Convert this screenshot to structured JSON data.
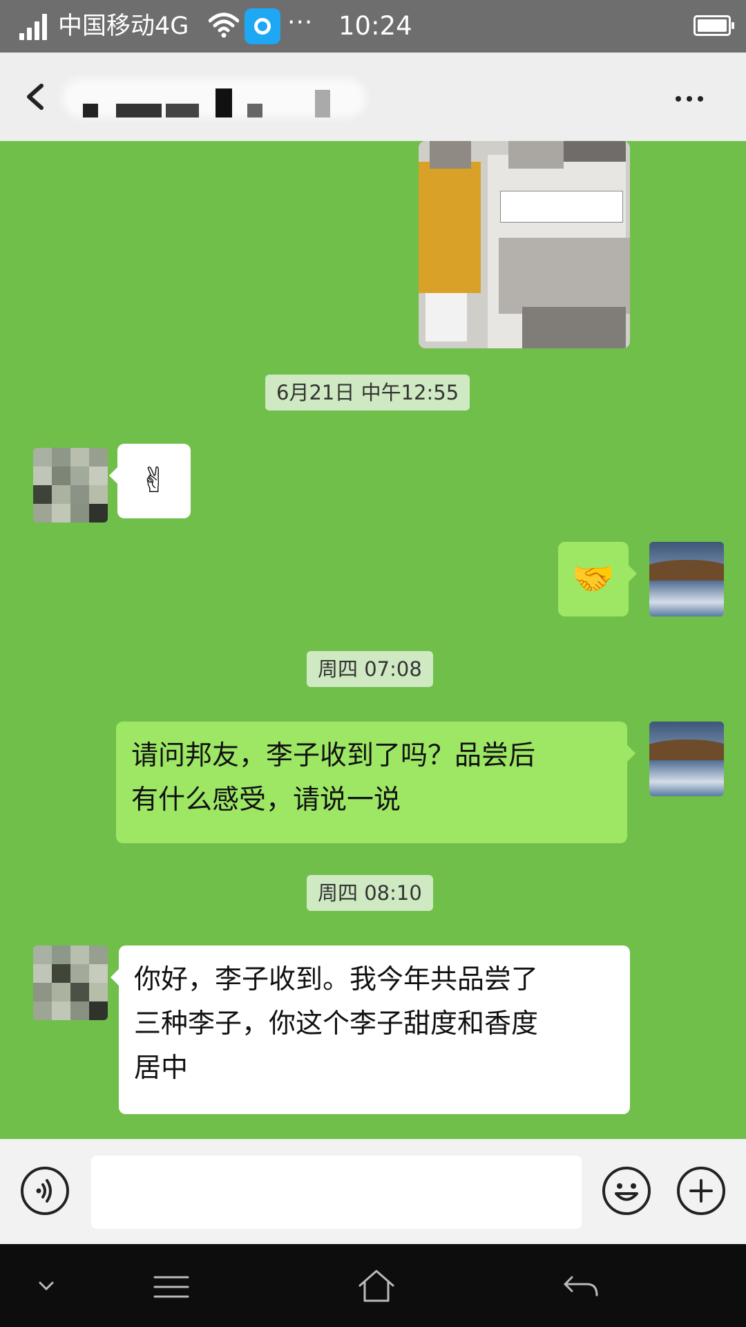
{
  "status_bar": {
    "carrier": "中国移动4G",
    "time": "10:24",
    "more": "···",
    "icons": [
      "signal-icon",
      "wifi-icon",
      "app-notification-icon",
      "battery-icon"
    ]
  },
  "header": {
    "icons": [
      "back-arrow-icon",
      "more-icon"
    ]
  },
  "messages": [
    {
      "type": "image",
      "side": "right",
      "description_icon": "package-photo"
    },
    {
      "type": "timestamp",
      "text": "6月21日 中午12:55"
    },
    {
      "type": "emoji",
      "side": "left",
      "emoji": "✌",
      "icon": "victory-hand-icon"
    },
    {
      "type": "emoji",
      "side": "right",
      "emoji": "🤝",
      "icon": "handshake-icon"
    },
    {
      "type": "timestamp",
      "text": "周四 07:08"
    },
    {
      "type": "text",
      "side": "right",
      "lines": [
        "请问邦友，李子收到了吗？品尝后",
        "有什么感受，请说一说"
      ]
    },
    {
      "type": "timestamp",
      "text": "周四 08:10"
    },
    {
      "type": "text",
      "side": "left",
      "lines": [
        "你好，李子收到。我今年共品尝了",
        "三种李子，你这个李子甜度和香度",
        "居中"
      ]
    }
  ],
  "input_bar": {
    "icons": [
      "voice-icon",
      "emoji-icon",
      "plus-icon"
    ],
    "value": ""
  },
  "nav_bar": {
    "icons": [
      "chevron-down-icon",
      "menu-icon",
      "home-icon",
      "back-icon"
    ]
  },
  "colors": {
    "chat_bg": "#6fbf4a",
    "my_bubble": "#9de765",
    "their_bubble": "#ffffff",
    "status_bar": "#6e6e6e",
    "header": "#eeeeee"
  }
}
